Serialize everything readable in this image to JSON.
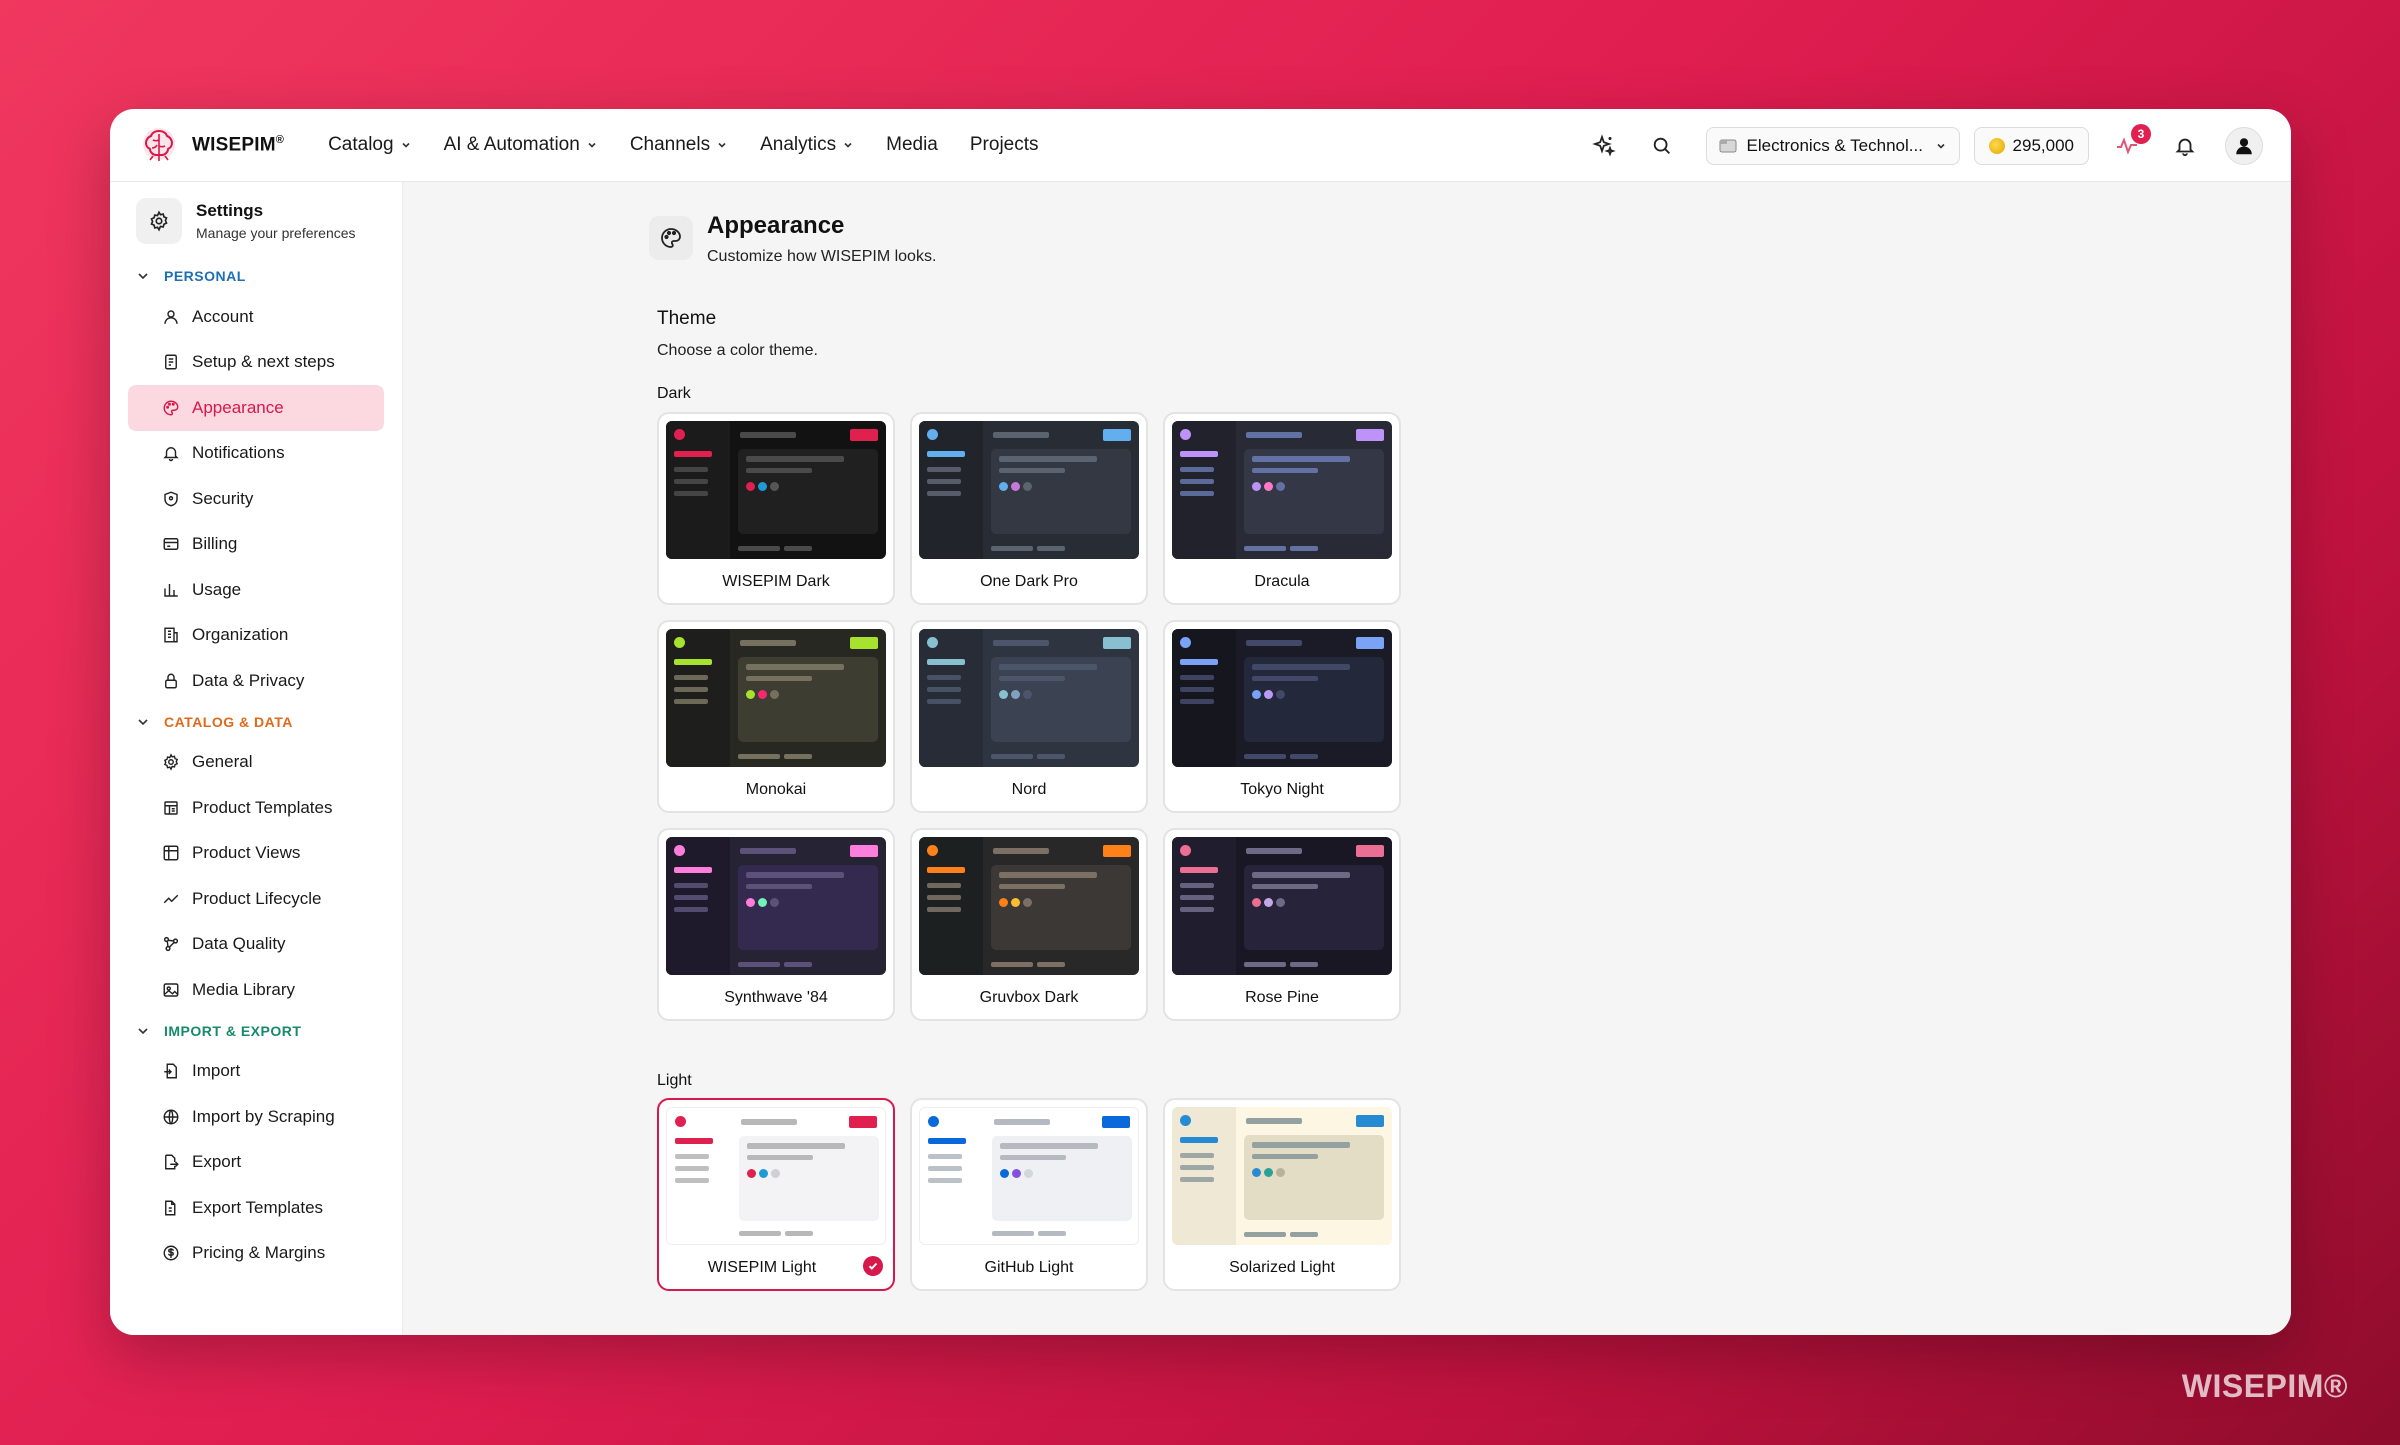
{
  "brand": {
    "name": "WISEPIM",
    "reg": "®",
    "watermark": "WISEPIM®"
  },
  "nav": [
    {
      "label": "Catalog",
      "dropdown": true
    },
    {
      "label": "AI & Automation",
      "dropdown": true
    },
    {
      "label": "Channels",
      "dropdown": true
    },
    {
      "label": "Analytics",
      "dropdown": true
    },
    {
      "label": "Media",
      "dropdown": false
    },
    {
      "label": "Projects",
      "dropdown": false
    }
  ],
  "topbar": {
    "org": "Electronics & Technol...",
    "credits": "295,000",
    "activity_badge": "3"
  },
  "sidebar": {
    "title": "Settings",
    "subtitle": "Manage your preferences",
    "sections": [
      {
        "label": "PERSONAL",
        "items": [
          {
            "label": "Account",
            "icon": "user-icon"
          },
          {
            "label": "Setup & next steps",
            "icon": "checklist-icon"
          },
          {
            "label": "Appearance",
            "icon": "palette-icon",
            "active": true
          },
          {
            "label": "Notifications",
            "icon": "bell-icon"
          },
          {
            "label": "Security",
            "icon": "shield-icon"
          },
          {
            "label": "Billing",
            "icon": "card-icon"
          },
          {
            "label": "Usage",
            "icon": "bar-chart-icon"
          },
          {
            "label": "Organization",
            "icon": "org-icon"
          },
          {
            "label": "Data & Privacy",
            "icon": "lock-icon"
          }
        ]
      },
      {
        "label": "CATALOG & DATA",
        "items": [
          {
            "label": "General",
            "icon": "gear-icon"
          },
          {
            "label": "Product Templates",
            "icon": "template-icon"
          },
          {
            "label": "Product Views",
            "icon": "table-icon"
          },
          {
            "label": "Product Lifecycle",
            "icon": "trend-icon"
          },
          {
            "label": "Data Quality",
            "icon": "quality-icon"
          },
          {
            "label": "Media Library",
            "icon": "image-icon"
          }
        ]
      },
      {
        "label": "IMPORT & EXPORT",
        "items": [
          {
            "label": "Import",
            "icon": "file-import-icon"
          },
          {
            "label": "Import by Scraping",
            "icon": "globe-icon"
          },
          {
            "label": "Export",
            "icon": "file-export-icon"
          },
          {
            "label": "Export Templates",
            "icon": "export-template-icon"
          },
          {
            "label": "Pricing & Margins",
            "icon": "dollar-icon"
          }
        ]
      }
    ]
  },
  "page": {
    "title": "Appearance",
    "subtitle": "Customize how WISEPIM looks."
  },
  "theme": {
    "title": "Theme",
    "subtitle": "Choose a color theme."
  },
  "groups": [
    {
      "label": "Dark",
      "themes": [
        {
          "name": "WISEPIM Dark",
          "colors": {
            "bg": "#121212",
            "side": "#1b1b1b",
            "panel": "#202020",
            "line": "#4a4a4a",
            "accent": "#e0204e",
            "c1": "#e0204e",
            "c2": "#1e9bd7",
            "c3": "#555555"
          }
        },
        {
          "name": "One Dark Pro",
          "colors": {
            "bg": "#282c34",
            "side": "#21252b",
            "panel": "#333842",
            "line": "#5c6370",
            "accent": "#61afef",
            "c1": "#61afef",
            "c2": "#c678dd",
            "c3": "#5c6370"
          }
        },
        {
          "name": "Dracula",
          "colors": {
            "bg": "#282a36",
            "side": "#21222c",
            "panel": "#343746",
            "line": "#6272a4",
            "accent": "#bd93f9",
            "c1": "#bd93f9",
            "c2": "#ff79c6",
            "c3": "#6272a4"
          }
        },
        {
          "name": "Monokai",
          "colors": {
            "bg": "#272822",
            "side": "#1e1f1c",
            "panel": "#3e3d32",
            "line": "#75715e",
            "accent": "#a6e22e",
            "c1": "#a6e22e",
            "c2": "#f92672",
            "c3": "#75715e"
          }
        },
        {
          "name": "Nord",
          "colors": {
            "bg": "#2e3440",
            "side": "#272c36",
            "panel": "#3b4252",
            "line": "#4c566a",
            "accent": "#88c0d0",
            "c1": "#88c0d0",
            "c2": "#81a1c1",
            "c3": "#4c566a"
          }
        },
        {
          "name": "Tokyo Night",
          "colors": {
            "bg": "#1a1b26",
            "side": "#16161e",
            "panel": "#24283b",
            "line": "#414868",
            "accent": "#7aa2f7",
            "c1": "#7aa2f7",
            "c2": "#bb9af7",
            "c3": "#414868"
          }
        },
        {
          "name": "Synthwave '84",
          "colors": {
            "bg": "#262335",
            "side": "#1e1a2c",
            "panel": "#34294f",
            "line": "#5a5278",
            "accent": "#ff7edb",
            "c1": "#ff7edb",
            "c2": "#72f1b8",
            "c3": "#5a5278"
          }
        },
        {
          "name": "Gruvbox Dark",
          "colors": {
            "bg": "#282828",
            "side": "#1d2021",
            "panel": "#3c3836",
            "line": "#7c6f64",
            "accent": "#fe8019",
            "c1": "#fe8019",
            "c2": "#fabd2f",
            "c3": "#7c6f64"
          }
        },
        {
          "name": "Rose Pine",
          "colors": {
            "bg": "#191724",
            "side": "#1f1d2e",
            "panel": "#26233a",
            "line": "#6e6a86",
            "accent": "#eb6f92",
            "c1": "#eb6f92",
            "c2": "#c4a7e7",
            "c3": "#6e6a86"
          }
        }
      ]
    },
    {
      "label": "Light",
      "themes": [
        {
          "name": "WISEPIM Light",
          "selected": true,
          "colors": {
            "bg": "#ffffff",
            "side": "#ffffff",
            "panel": "#f3f3f5",
            "line": "#b8b8b8",
            "accent": "#e0204e",
            "c1": "#e0204e",
            "c2": "#1e9bd7",
            "c3": "#d0d0d0"
          }
        },
        {
          "name": "GitHub Light",
          "colors": {
            "bg": "#ffffff",
            "side": "#ffffff",
            "panel": "#eef0f3",
            "line": "#b5bac2",
            "accent": "#0969da",
            "c1": "#0969da",
            "c2": "#8250df",
            "c3": "#d0d7de"
          }
        },
        {
          "name": "Solarized Light",
          "colors": {
            "bg": "#fdf6e3",
            "side": "#eee8d5",
            "panel": "#e4ddc5",
            "line": "#93a1a1",
            "accent": "#268bd2",
            "c1": "#268bd2",
            "c2": "#2aa198",
            "c3": "#b8b29c"
          }
        }
      ]
    }
  ]
}
